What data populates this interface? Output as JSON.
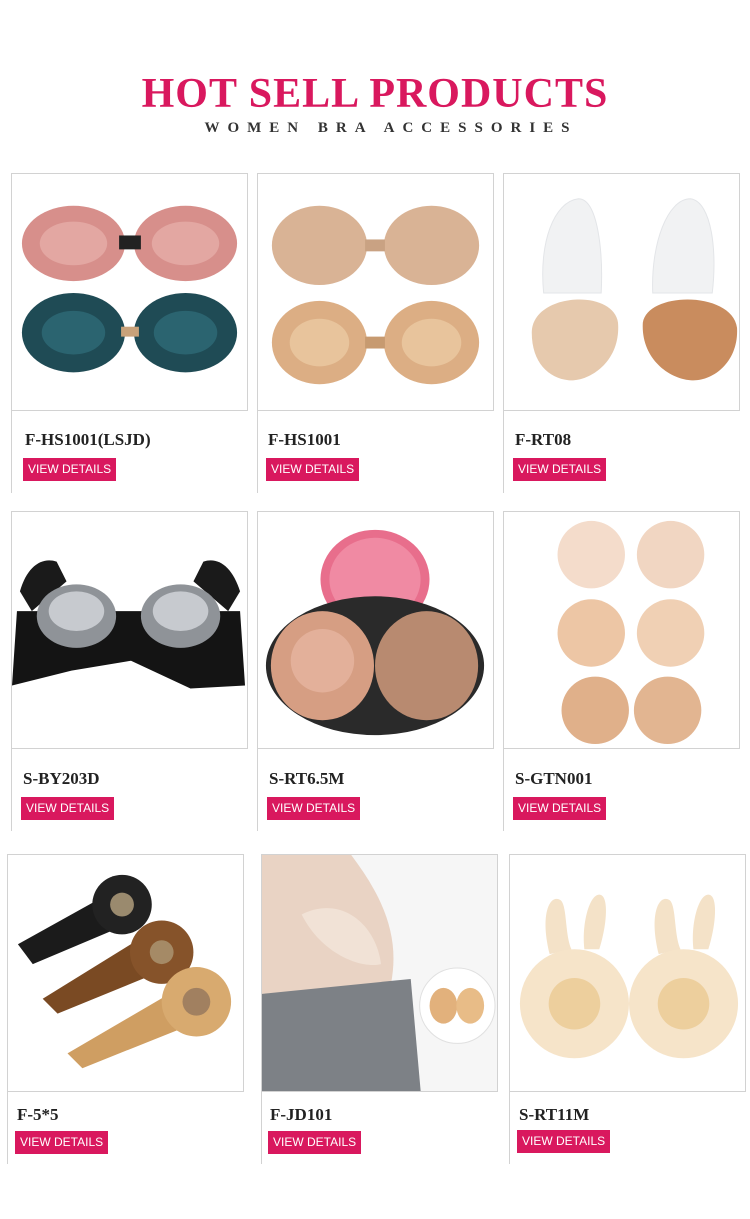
{
  "header": {
    "title": "HOT SELL PRODUCTS",
    "subtitle": "WOMEN BRA ACCESSORIES"
  },
  "products": [
    {
      "name": "F-HS1001(LSJD)",
      "button": "VIEW DETAILS",
      "image": "pink-and-teal-adhesive-bras"
    },
    {
      "name": "F-HS1001",
      "button": "VIEW DETAILS",
      "image": "nude-adhesive-bra-front-and-back"
    },
    {
      "name": "F-RT08",
      "button": "VIEW DETAILS",
      "image": "lift-up-nipple-covers"
    },
    {
      "name": "S-BY203D",
      "button": "VIEW DETAILS",
      "image": "black-bra-with-silicone-cups"
    },
    {
      "name": "S-RT6.5M",
      "button": "VIEW DETAILS",
      "image": "nipple-covers-in-pink-case"
    },
    {
      "name": "S-GTN001",
      "button": "VIEW DETAILS",
      "image": "six-round-nipple-covers"
    },
    {
      "name": "F-5*5",
      "button": "VIEW DETAILS",
      "image": "boob-tape-rolls"
    },
    {
      "name": "F-JD101",
      "button": "VIEW DETAILS",
      "image": "shoulder-pad-model"
    },
    {
      "name": "S-RT11M",
      "button": "VIEW DETAILS",
      "image": "rabbit-ear-nipple-covers"
    }
  ],
  "colors": {
    "accent": "#d9185e",
    "border": "#d2d2d2",
    "text": "#222222"
  }
}
